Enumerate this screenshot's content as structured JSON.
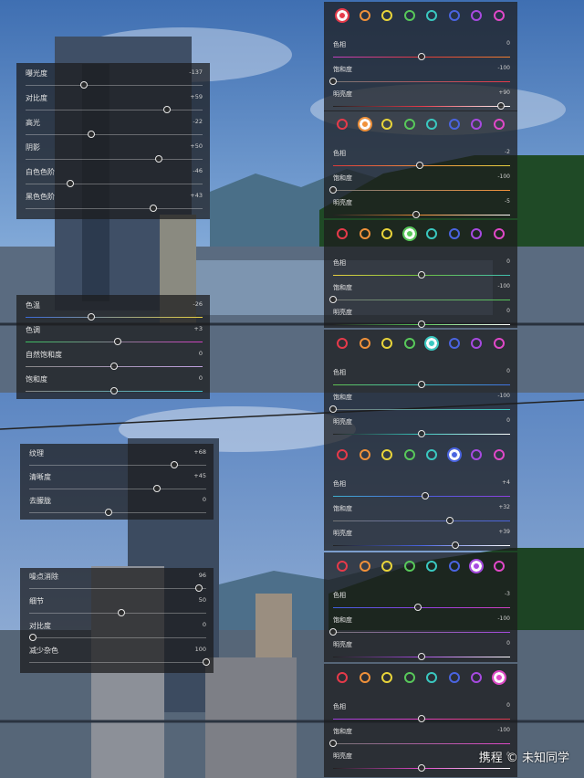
{
  "panels": {
    "light": [
      {
        "label": "曝光度",
        "value": "-137",
        "fraction": 0.33
      },
      {
        "label": "对比度",
        "value": "+59",
        "fraction": 0.8
      },
      {
        "label": "高光",
        "value": "-22",
        "fraction": 0.37
      },
      {
        "label": "阴影",
        "value": "+50",
        "fraction": 0.75
      },
      {
        "label": "白色色阶",
        "value": "-46",
        "fraction": 0.25
      },
      {
        "label": "黑色色阶",
        "value": "+43",
        "fraction": 0.72
      }
    ],
    "color": [
      {
        "label": "色温",
        "value": "-26",
        "fraction": 0.37
      },
      {
        "label": "色调",
        "value": "+3",
        "fraction": 0.52
      },
      {
        "label": "自然饱和度",
        "value": "0",
        "fraction": 0.5
      },
      {
        "label": "饱和度",
        "value": "0",
        "fraction": 0.5
      }
    ],
    "effects": [
      {
        "label": "纹理",
        "value": "+68",
        "fraction": 0.82
      },
      {
        "label": "清晰度",
        "value": "+45",
        "fraction": 0.72
      },
      {
        "label": "去朦胧",
        "value": "0",
        "fraction": 0.45
      }
    ],
    "detail": [
      {
        "label": "噪点消除",
        "value": "96",
        "fraction": 0.96
      },
      {
        "label": "细节",
        "value": "50",
        "fraction": 0.52
      },
      {
        "label": "对比度",
        "value": "0",
        "fraction": 0.02
      },
      {
        "label": "减少杂色",
        "value": "100",
        "fraction": 1.0
      }
    ]
  },
  "hsl_colors": [
    "#e63a4a",
    "#f0913a",
    "#e8d43a",
    "#58c85a",
    "#3ac8c0",
    "#4a64e0",
    "#a64ae0",
    "#e048c8"
  ],
  "hsl_blocks": [
    {
      "selected": 0,
      "hue": "0",
      "hue_f": 0.5,
      "sat": "-100",
      "sat_f": 0.0,
      "lum": "+90",
      "lum_f": 0.95
    },
    {
      "selected": 1,
      "hue": "-2",
      "hue_f": 0.49,
      "sat": "-100",
      "sat_f": 0.0,
      "lum": "-5",
      "lum_f": 0.47
    },
    {
      "selected": 3,
      "hue": "0",
      "hue_f": 0.5,
      "sat": "-100",
      "sat_f": 0.0,
      "lum": "0",
      "lum_f": 0.5
    },
    {
      "selected": 4,
      "hue": "0",
      "hue_f": 0.5,
      "sat": "-100",
      "sat_f": 0.0,
      "lum": "0",
      "lum_f": 0.5
    },
    {
      "selected": 5,
      "hue": "+4",
      "hue_f": 0.52,
      "sat": "+32",
      "sat_f": 0.66,
      "lum": "+39",
      "lum_f": 0.69
    },
    {
      "selected": 6,
      "hue": "-3",
      "hue_f": 0.48,
      "sat": "-100",
      "sat_f": 0.0,
      "lum": "0",
      "lum_f": 0.5
    },
    {
      "selected": 7,
      "hue": "0",
      "hue_f": 0.5,
      "sat": "-100",
      "sat_f": 0.0,
      "lum": "0",
      "lum_f": 0.5
    }
  ],
  "hsl_labels": {
    "hue": "色相",
    "sat": "饱和度",
    "lum": "明亮度"
  },
  "watermark": "携程 © 未知同学"
}
